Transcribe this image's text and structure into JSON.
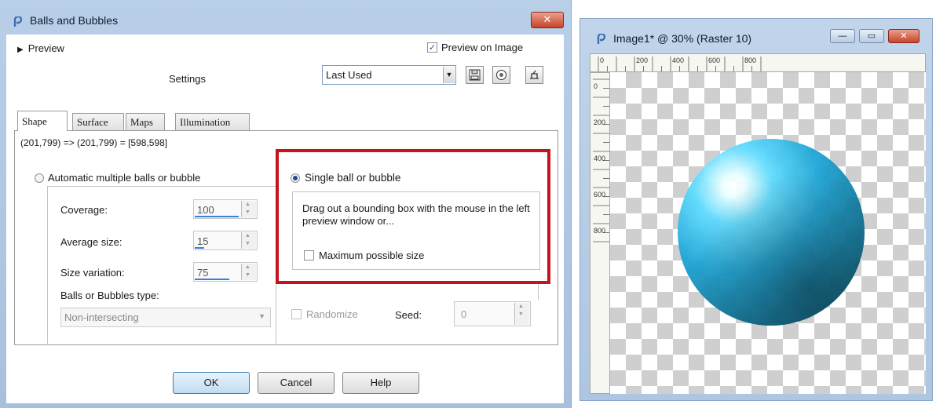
{
  "dialog": {
    "title": "Balls and Bubbles",
    "close_glyph": "✕",
    "preview_label": "Preview",
    "preview_on_image_label": "Preview on Image",
    "preview_on_image_checked": true,
    "settings_label": "Settings",
    "preset_value": "Last Used",
    "tabs": [
      "Shape",
      "Surface",
      "Maps",
      "Illumination"
    ],
    "coords_text": "(201,799) => (201,799) = [598,598]",
    "auto": {
      "label": "Automatic multiple balls or bubble",
      "selected": false,
      "coverage_label": "Coverage:",
      "coverage_value": "100",
      "avg_size_label": "Average size:",
      "avg_size_value": "15",
      "size_var_label": "Size variation:",
      "size_var_value": "75",
      "type_label": "Balls or Bubbles type:",
      "type_value": "Non-intersecting"
    },
    "single": {
      "label": "Single ball or bubble",
      "selected": true,
      "description": "Drag out a bounding box with the mouse in the left preview window or...",
      "max_size_label": "Maximum possible size",
      "max_size_checked": false
    },
    "randomize_label": "Randomize",
    "seed_label": "Seed:",
    "seed_value": "0",
    "buttons": {
      "ok": "OK",
      "cancel": "Cancel",
      "help": "Help"
    },
    "highlight_color": "#c5131c"
  },
  "image_window": {
    "title": "Image1* @  30% (Raster 10)",
    "zoom": "30%",
    "ruler_top_labels": [
      "0",
      "200",
      "400",
      "600",
      "800"
    ],
    "ruler_left_labels": [
      "0",
      "200",
      "400",
      "600",
      "800"
    ],
    "sphere_color": "#1ea6d7"
  }
}
